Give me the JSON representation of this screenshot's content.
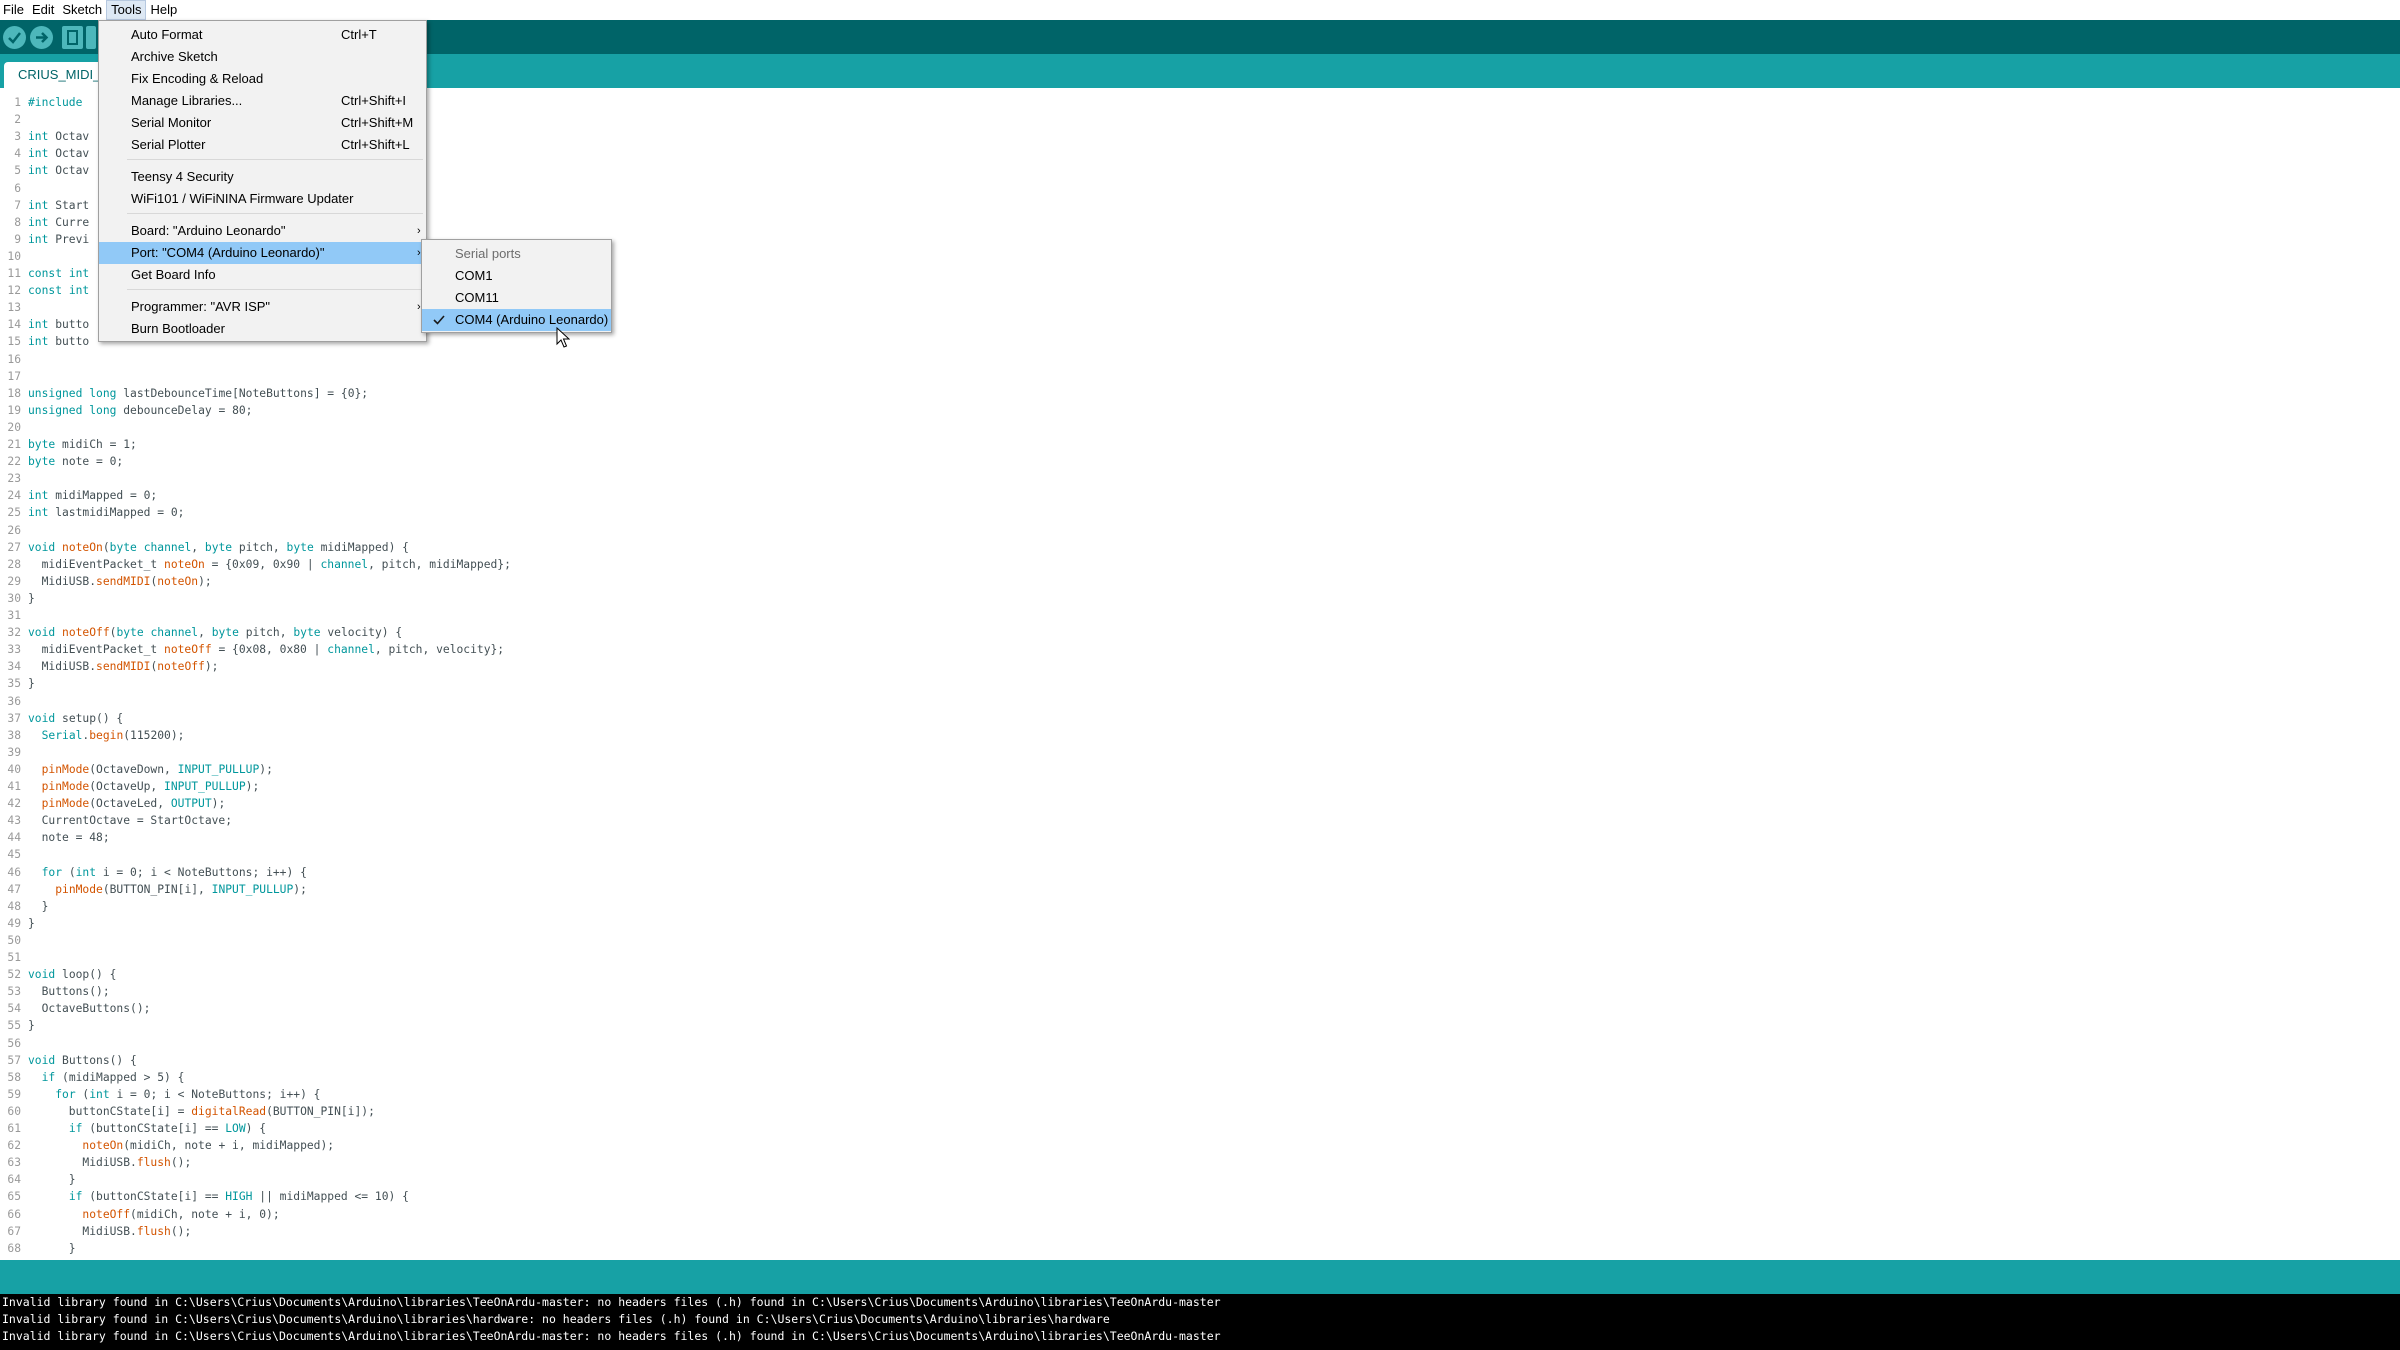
{
  "menubar": {
    "items": [
      "File",
      "Edit",
      "Sketch",
      "Tools",
      "Help"
    ],
    "active": "Tools"
  },
  "tab": {
    "label": "CRIUS_MIDI_F"
  },
  "tools_menu": {
    "items": [
      {
        "label": "Auto Format",
        "shortcut": "Ctrl+T"
      },
      {
        "label": "Archive Sketch",
        "shortcut": ""
      },
      {
        "label": "Fix Encoding & Reload",
        "shortcut": ""
      },
      {
        "label": "Manage Libraries...",
        "shortcut": "Ctrl+Shift+I"
      },
      {
        "label": "Serial Monitor",
        "shortcut": "Ctrl+Shift+M"
      },
      {
        "label": "Serial Plotter",
        "shortcut": "Ctrl+Shift+L"
      },
      {
        "label": "Teensy 4 Security",
        "shortcut": ""
      },
      {
        "label": "WiFi101 / WiFiNINA Firmware Updater",
        "shortcut": ""
      },
      {
        "label": "Board: \"Arduino Leonardo\"",
        "shortcut": ""
      },
      {
        "label": "Port: \"COM4 (Arduino Leonardo)\"",
        "shortcut": ""
      },
      {
        "label": "Get Board Info",
        "shortcut": ""
      },
      {
        "label": "Programmer: \"AVR ISP\"",
        "shortcut": ""
      },
      {
        "label": "Burn Bootloader",
        "shortcut": ""
      }
    ]
  },
  "ports_menu": {
    "header": "Serial ports",
    "items": [
      "COM1",
      "COM11",
      "COM4 (Arduino Leonardo)"
    ],
    "selected": "COM4 (Arduino Leonardo)"
  },
  "code_lines": [
    "#include",
    "",
    "int Octav",
    "int Octav",
    "int Octav",
    "",
    "int Start",
    "int Curre",
    "int Previ",
    "",
    "const int",
    "const int",
    "",
    "int butto",
    "int butto",
    "",
    "",
    "unsigned long lastDebounceTime[NoteButtons] = {0};",
    "unsigned long debounceDelay = 80;",
    "",
    "byte midiCh = 1;",
    "byte note = 0;",
    "",
    "int midiMapped = 0;",
    "int lastmidiMapped = 0;",
    "",
    "void noteOn(byte channel, byte pitch, byte midiMapped) {",
    "  midiEventPacket_t noteOn = {0x09, 0x90 | channel, pitch, midiMapped};",
    "  MidiUSB.sendMIDI(noteOn);",
    "}",
    "",
    "void noteOff(byte channel, byte pitch, byte velocity) {",
    "  midiEventPacket_t noteOff = {0x08, 0x80 | channel, pitch, velocity};",
    "  MidiUSB.sendMIDI(noteOff);",
    "}",
    "",
    "void setup() {",
    "  Serial.begin(115200);",
    "",
    "  pinMode(OctaveDown, INPUT_PULLUP);",
    "  pinMode(OctaveUp, INPUT_PULLUP);",
    "  pinMode(OctaveLed, OUTPUT);",
    "  CurrentOctave = StartOctave;",
    "  note = 48;",
    "",
    "  for (int i = 0; i < NoteButtons; i++) {",
    "    pinMode(BUTTON_PIN[i], INPUT_PULLUP);",
    "  }",
    "}",
    "",
    "",
    "void loop() {",
    "  Buttons();",
    "  OctaveButtons();",
    "}",
    "",
    "void Buttons() {",
    "  if (midiMapped > 5) {",
    "    for (int i = 0; i < NoteButtons; i++) {",
    "      buttonCState[i] = digitalRead(BUTTON_PIN[i]);",
    "      if (buttonCState[i] == LOW) {",
    "        noteOn(midiCh, note + i, midiMapped);",
    "        MidiUSB.flush();",
    "      }",
    "      if (buttonCState[i] == HIGH || midiMapped <= 10) {",
    "        noteOff(midiCh, note + i, 0);",
    "        MidiUSB.flush();",
    "      }"
  ],
  "console_lines": [
    "Invalid library found in C:\\Users\\Crius\\Documents\\Arduino\\libraries\\TeeOnArdu-master: no headers files (.h) found in C:\\Users\\Crius\\Documents\\Arduino\\libraries\\TeeOnArdu-master",
    "Invalid library found in C:\\Users\\Crius\\Documents\\Arduino\\libraries\\hardware: no headers files (.h) found in C:\\Users\\Crius\\Documents\\Arduino\\libraries\\hardware",
    "Invalid library found in C:\\Users\\Crius\\Documents\\Arduino\\libraries\\TeeOnArdu-master: no headers files (.h) found in C:\\Users\\Crius\\Documents\\Arduino\\libraries\\TeeOnArdu-master"
  ],
  "colors": {
    "toolbar": "#006468",
    "tabstrip": "#17a1a5",
    "keyword": "#00979c",
    "function": "#d35400",
    "menu_highlight": "#91c9f7"
  },
  "icons": [
    "verify-icon",
    "upload-icon",
    "new-sketch-icon",
    "check-icon",
    "chevron-right-icon",
    "mouse-pointer-icon"
  ]
}
